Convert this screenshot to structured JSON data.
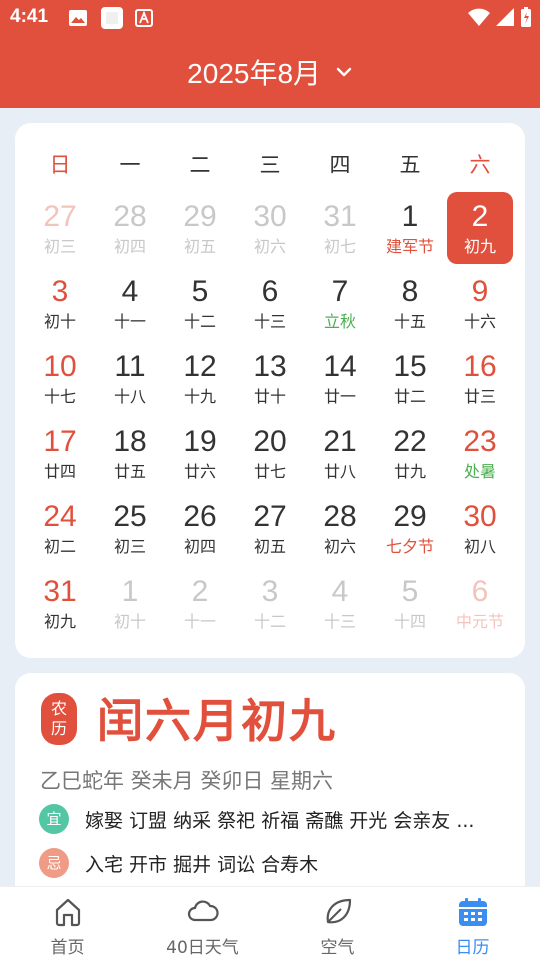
{
  "status_bar": {
    "time": "4:41"
  },
  "header": {
    "month_title": "2025年8月"
  },
  "weekdays": [
    "日",
    "一",
    "二",
    "三",
    "四",
    "五",
    "六"
  ],
  "calendar": {
    "days": [
      {
        "num": "27",
        "lunar": "初三",
        "other": true
      },
      {
        "num": "28",
        "lunar": "初四",
        "other": true
      },
      {
        "num": "29",
        "lunar": "初五",
        "other": true
      },
      {
        "num": "30",
        "lunar": "初六",
        "other": true
      },
      {
        "num": "31",
        "lunar": "初七",
        "other": true
      },
      {
        "num": "1",
        "lunar": "建军节",
        "kind": "festival"
      },
      {
        "num": "2",
        "lunar": "初九",
        "selected": true
      },
      {
        "num": "3",
        "lunar": "初十"
      },
      {
        "num": "4",
        "lunar": "十一"
      },
      {
        "num": "5",
        "lunar": "十二"
      },
      {
        "num": "6",
        "lunar": "十三"
      },
      {
        "num": "7",
        "lunar": "立秋",
        "kind": "term"
      },
      {
        "num": "8",
        "lunar": "十五"
      },
      {
        "num": "9",
        "lunar": "十六"
      },
      {
        "num": "10",
        "lunar": "十七"
      },
      {
        "num": "11",
        "lunar": "十八"
      },
      {
        "num": "12",
        "lunar": "十九"
      },
      {
        "num": "13",
        "lunar": "廿十"
      },
      {
        "num": "14",
        "lunar": "廿一"
      },
      {
        "num": "15",
        "lunar": "廿二"
      },
      {
        "num": "16",
        "lunar": "廿三"
      },
      {
        "num": "17",
        "lunar": "廿四"
      },
      {
        "num": "18",
        "lunar": "廿五"
      },
      {
        "num": "19",
        "lunar": "廿六"
      },
      {
        "num": "20",
        "lunar": "廿七"
      },
      {
        "num": "21",
        "lunar": "廿八"
      },
      {
        "num": "22",
        "lunar": "廿九"
      },
      {
        "num": "23",
        "lunar": "处暑",
        "kind": "term"
      },
      {
        "num": "24",
        "lunar": "初二"
      },
      {
        "num": "25",
        "lunar": "初三"
      },
      {
        "num": "26",
        "lunar": "初四"
      },
      {
        "num": "27",
        "lunar": "初五"
      },
      {
        "num": "28",
        "lunar": "初六"
      },
      {
        "num": "29",
        "lunar": "七夕节",
        "kind": "festival"
      },
      {
        "num": "30",
        "lunar": "初八"
      },
      {
        "num": "31",
        "lunar": "初九"
      },
      {
        "num": "1",
        "lunar": "初十",
        "other": true
      },
      {
        "num": "2",
        "lunar": "十一",
        "other": true
      },
      {
        "num": "3",
        "lunar": "十二",
        "other": true
      },
      {
        "num": "4",
        "lunar": "十三",
        "other": true
      },
      {
        "num": "5",
        "lunar": "十四",
        "other": true
      },
      {
        "num": "6",
        "lunar": "中元节",
        "other": true,
        "kind": "festival"
      }
    ]
  },
  "lunar_info": {
    "seal": "农历",
    "date": "闰六月初九",
    "ganzhi": "乙巳蛇年 癸未月 癸卯日 星期六",
    "yi_label": "宜",
    "yi_text": "嫁娶 订盟 纳采 祭祀 祈福 斋醮 开光 会亲友 ...",
    "ji_label": "忌",
    "ji_text": "入宅 开市 掘井 词讼 合寿木"
  },
  "tabs": [
    {
      "label": "首页",
      "icon": "home-icon"
    },
    {
      "label": "40日天气",
      "icon": "cloud-icon"
    },
    {
      "label": "空气",
      "icon": "leaf-icon"
    },
    {
      "label": "日历",
      "icon": "calendar-icon",
      "active": true
    }
  ],
  "colors": {
    "primary": "#e0503c",
    "active_tab": "#3b8df0",
    "term": "#4caf50",
    "yi": "#53c7a4",
    "ji": "#f09b85"
  }
}
